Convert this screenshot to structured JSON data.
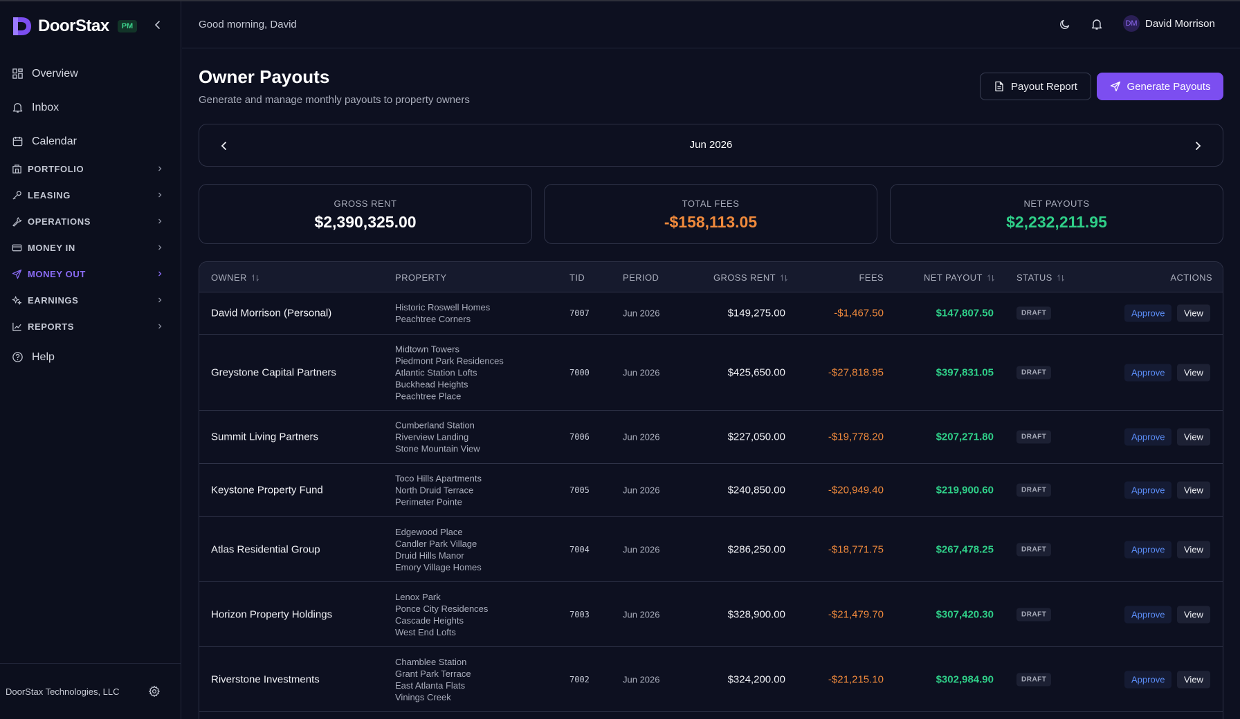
{
  "app": {
    "name": "DoorStax",
    "badge": "PM"
  },
  "sidebar": {
    "main": [
      {
        "label": "Overview"
      },
      {
        "label": "Inbox"
      },
      {
        "label": "Calendar"
      }
    ],
    "sections": [
      {
        "label": "PORTFOLIO"
      },
      {
        "label": "LEASING"
      },
      {
        "label": "OPERATIONS"
      },
      {
        "label": "MONEY IN"
      },
      {
        "label": "MONEY OUT",
        "active": true
      },
      {
        "label": "EARNINGS"
      },
      {
        "label": "REPORTS"
      }
    ],
    "help": "Help",
    "company": "DoorStax Technologies, LLC"
  },
  "header": {
    "greeting": "Good morning, David",
    "user_initials": "DM",
    "user_name": "David Morrison"
  },
  "page": {
    "title": "Owner Payouts",
    "subtitle": "Generate and manage monthly payouts to property owners",
    "report_button": "Payout Report",
    "generate_button": "Generate Payouts",
    "period": "Jun 2026"
  },
  "stats": {
    "gross_label": "GROSS RENT",
    "gross_value": "$2,390,325.00",
    "fees_label": "TOTAL FEES",
    "fees_value": "-$158,113.05",
    "net_label": "NET PAYOUTS",
    "net_value": "$2,232,211.95"
  },
  "colors": {
    "accent": "#7c4ef0",
    "fees": "#f08a3c",
    "net": "#2fcf88",
    "approve": "#5b8df7"
  },
  "table": {
    "headers": {
      "owner": "OWNER",
      "property": "PROPERTY",
      "tid": "TID",
      "period": "PERIOD",
      "gross": "GROSS RENT",
      "fees": "FEES",
      "net": "NET PAYOUT",
      "status": "STATUS",
      "actions": "ACTIONS"
    },
    "approve_label": "Approve",
    "view_label": "View",
    "rows": [
      {
        "owner": "David Morrison (Personal)",
        "properties": [
          "Historic Roswell Homes",
          "Peachtree Corners"
        ],
        "tid": "7007",
        "period": "Jun 2026",
        "gross": "$149,275.00",
        "fees": "-$1,467.50",
        "net": "$147,807.50",
        "status": "DRAFT"
      },
      {
        "owner": "Greystone Capital Partners",
        "properties": [
          "Midtown Towers",
          "Piedmont Park Residences",
          "Atlantic Station Lofts",
          "Buckhead Heights",
          "Peachtree Place"
        ],
        "tid": "7000",
        "period": "Jun 2026",
        "gross": "$425,650.00",
        "fees": "-$27,818.95",
        "net": "$397,831.05",
        "status": "DRAFT"
      },
      {
        "owner": "Summit Living Partners",
        "properties": [
          "Cumberland Station",
          "Riverview Landing",
          "Stone Mountain View"
        ],
        "tid": "7006",
        "period": "Jun 2026",
        "gross": "$227,050.00",
        "fees": "-$19,778.20",
        "net": "$207,271.80",
        "status": "DRAFT"
      },
      {
        "owner": "Keystone Property Fund",
        "properties": [
          "Toco Hills Apartments",
          "North Druid Terrace",
          "Perimeter Pointe"
        ],
        "tid": "7005",
        "period": "Jun 2026",
        "gross": "$240,850.00",
        "fees": "-$20,949.40",
        "net": "$219,900.60",
        "status": "DRAFT"
      },
      {
        "owner": "Atlas Residential Group",
        "properties": [
          "Edgewood Place",
          "Candler Park Village",
          "Druid Hills Manor",
          "Emory Village Homes"
        ],
        "tid": "7004",
        "period": "Jun 2026",
        "gross": "$286,250.00",
        "fees": "-$18,771.75",
        "net": "$267,478.25",
        "status": "DRAFT"
      },
      {
        "owner": "Horizon Property Holdings",
        "properties": [
          "Lenox Park",
          "Ponce City Residences",
          "Cascade Heights",
          "West End Lofts"
        ],
        "tid": "7003",
        "period": "Jun 2026",
        "gross": "$328,900.00",
        "fees": "-$21,479.70",
        "net": "$307,420.30",
        "status": "DRAFT"
      },
      {
        "owner": "Riverstone Investments",
        "properties": [
          "Chamblee Station",
          "Grant Park Terrace",
          "East Atlanta Flats",
          "Vinings Creek"
        ],
        "tid": "7002",
        "period": "Jun 2026",
        "gross": "$324,200.00",
        "fees": "-$21,215.10",
        "net": "$302,984.90",
        "status": "DRAFT"
      }
    ]
  }
}
